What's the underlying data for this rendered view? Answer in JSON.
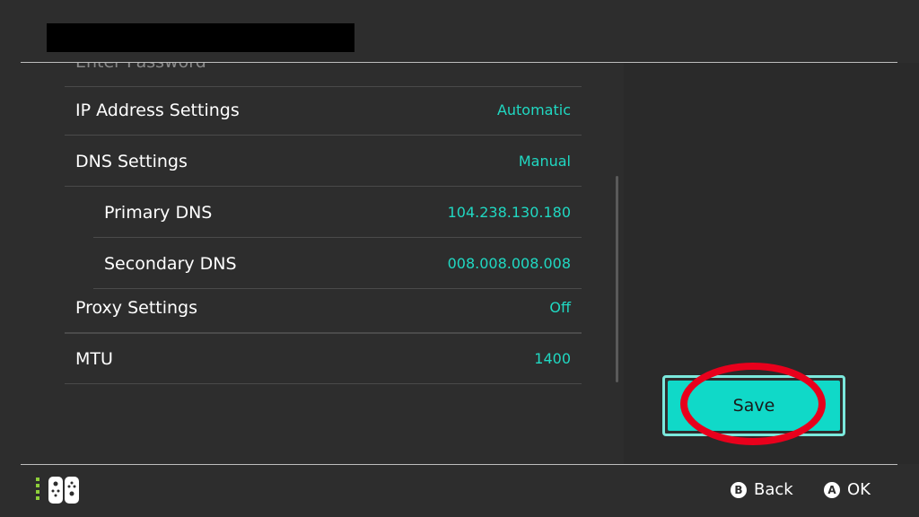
{
  "header": {
    "title_redacted": true
  },
  "settings": {
    "partial_row": {
      "label": "Enter Password"
    },
    "rows": [
      {
        "label": "IP Address Settings",
        "value": "Automatic"
      },
      {
        "label": "DNS Settings",
        "value": "Manual"
      },
      {
        "label": "Primary DNS",
        "value": "104.238.130.180"
      },
      {
        "label": "Secondary DNS",
        "value": "008.008.008.008"
      },
      {
        "label": "Proxy Settings",
        "value": "Off"
      },
      {
        "label": "MTU",
        "value": "1400"
      }
    ]
  },
  "actions": {
    "save_label": "Save"
  },
  "footer": {
    "back": {
      "button": "B",
      "label": "Back"
    },
    "ok": {
      "button": "A",
      "label": "OK"
    }
  },
  "colors": {
    "value_accent": "#20d8c2",
    "save_button": "#10d9c8",
    "highlight_ring": "#e8001c",
    "background": "#2d2d2d"
  },
  "icons": [
    "controller-icon",
    "b-button-icon",
    "a-button-icon"
  ]
}
